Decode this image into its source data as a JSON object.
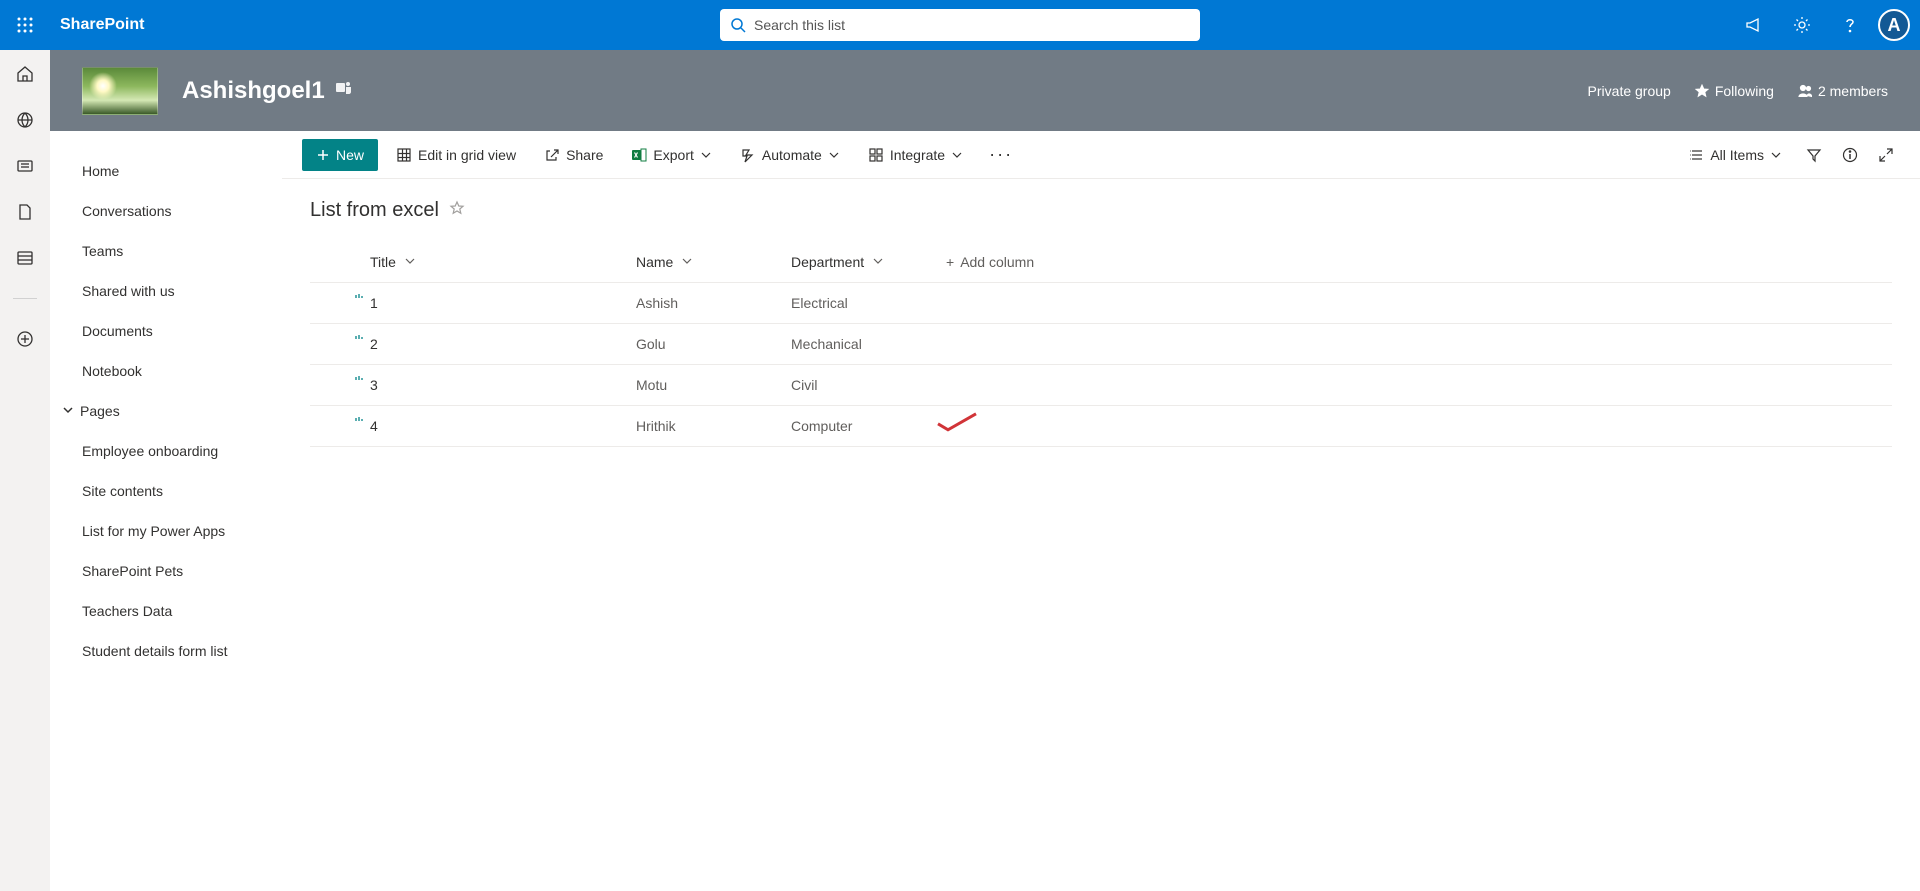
{
  "brand": "SharePoint",
  "search": {
    "placeholder": "Search this list"
  },
  "avatar_initial": "A",
  "site": {
    "title": "Ashishgoel1",
    "privacy": "Private group",
    "following_label": "Following",
    "members_label": "2 members"
  },
  "leftnav": {
    "items": [
      "Home",
      "Conversations",
      "Teams",
      "Shared with us",
      "Documents",
      "Notebook",
      "Pages",
      "Employee onboarding",
      "Site contents",
      "List for my Power Apps",
      "SharePoint Pets",
      "Teachers Data",
      "Student details form list"
    ],
    "pages_index": 6
  },
  "commands": {
    "new": "New",
    "edit_grid": "Edit in grid view",
    "share": "Share",
    "export": "Export",
    "automate": "Automate",
    "integrate": "Integrate",
    "view_label": "All Items"
  },
  "list": {
    "title": "List from excel",
    "columns": {
      "title": "Title",
      "name": "Name",
      "department": "Department",
      "add": "Add column"
    },
    "rows": [
      {
        "title": "1",
        "name": "Ashish",
        "department": "Electrical"
      },
      {
        "title": "2",
        "name": "Golu",
        "department": "Mechanical"
      },
      {
        "title": "3",
        "name": "Motu",
        "department": "Civil"
      },
      {
        "title": "4",
        "name": "Hrithik",
        "department": "Computer"
      }
    ],
    "checkmark_row_index": 3
  }
}
